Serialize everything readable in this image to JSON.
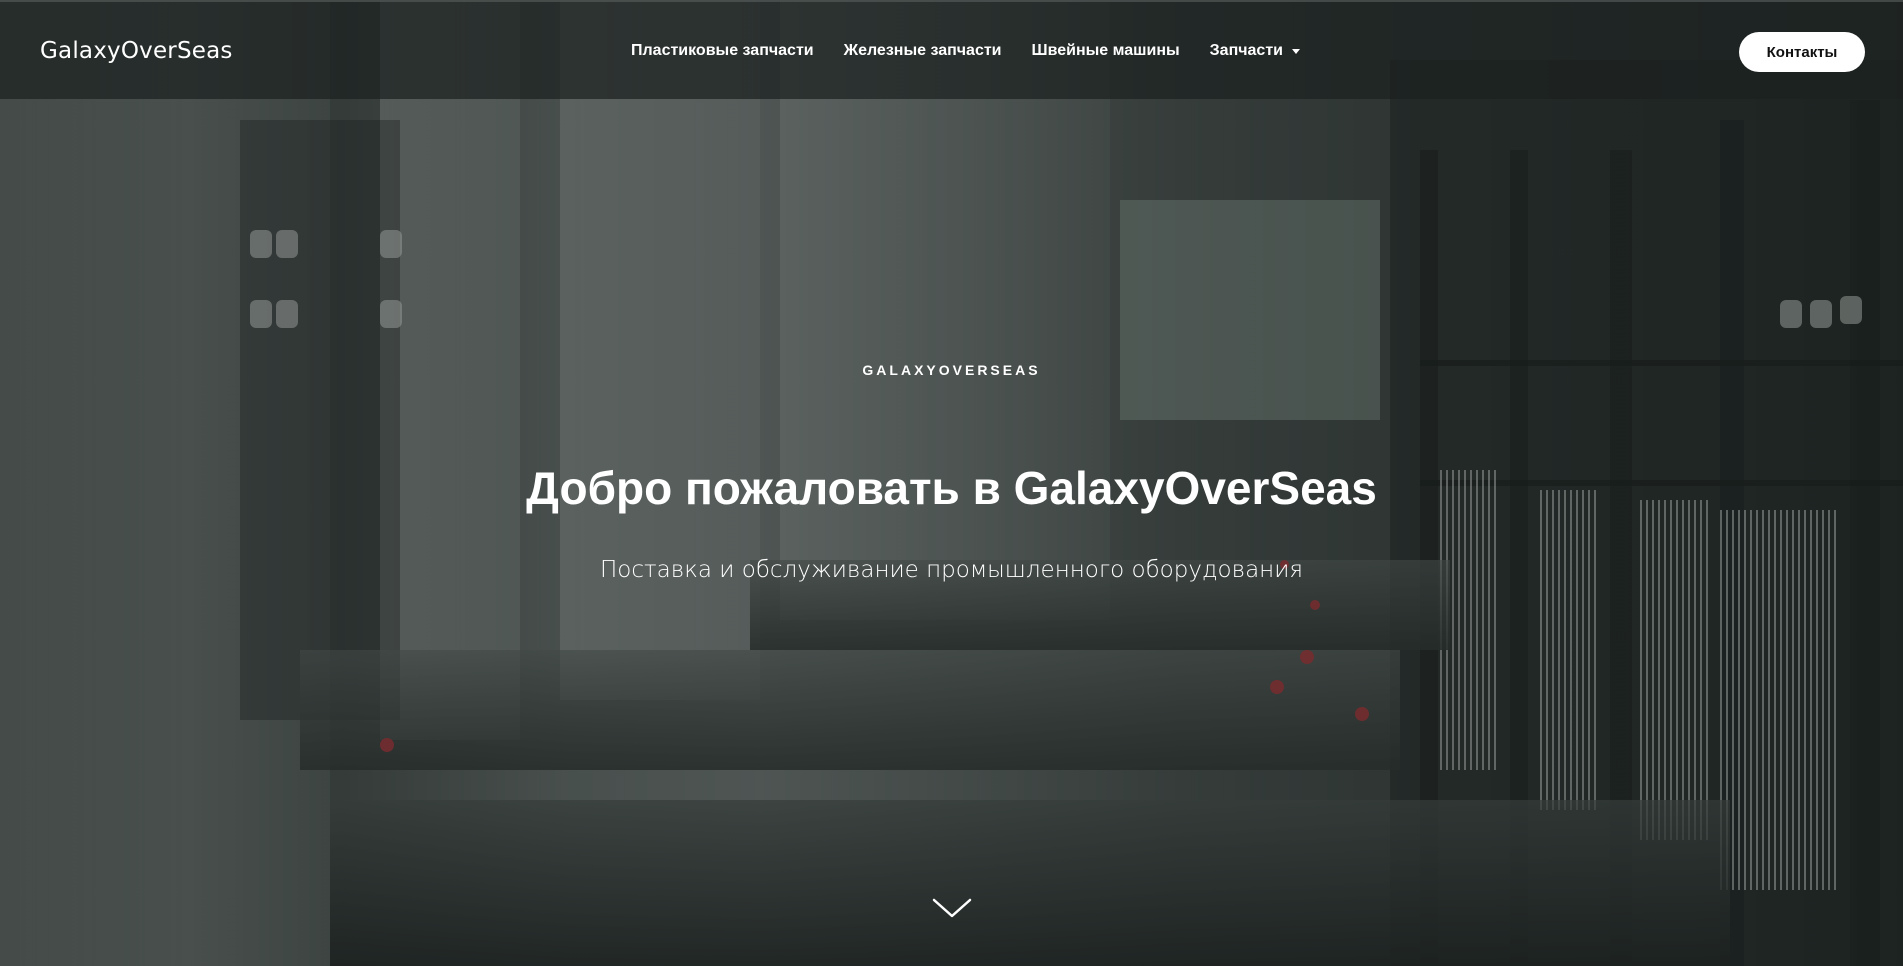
{
  "header": {
    "brand": "GalaxyOverSeas",
    "nav": [
      {
        "label": "Пластиковые запчасти"
      },
      {
        "label": "Железные запчасти"
      },
      {
        "label": "Швейные машины"
      },
      {
        "label": "Запчасти",
        "has_dropdown": true
      }
    ],
    "contact_label": "Контакты"
  },
  "hero": {
    "eyebrow": "GALAXYOVERSEAS",
    "title": "Добро пожаловать в GalaxyOverSeas",
    "subtitle": "Поставка и обслуживание промышленного оборудования"
  },
  "icons": {
    "dropdown": "chevron-down-icon",
    "scroll": "chevron-down-icon"
  },
  "colors": {
    "overlay": "#1c2120",
    "text": "#ffffff",
    "button_bg": "#ffffff",
    "button_text": "#111111"
  }
}
